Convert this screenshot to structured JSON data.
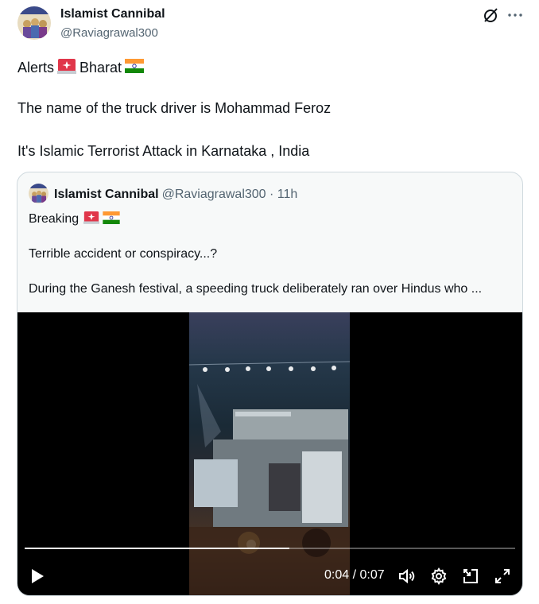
{
  "post": {
    "author_name": "Islamist Cannibal",
    "author_handle": "@Raviagrawal300",
    "lines": [
      {
        "before": "Alerts",
        "after": "Bharat"
      },
      {
        "text": "The name of the truck driver is Mohammad Feroz"
      },
      {
        "text": "It's Islamic Terrorist Attack in Karnataka , India"
      }
    ],
    "icons": [
      "grok-icon",
      "more-icon",
      "police-light-emoji",
      "india-flag-emoji"
    ]
  },
  "quoted": {
    "author_name": "Islamist Cannibal",
    "meta": "@Raviagrawal300 · 11h",
    "lines": [
      {
        "text": "Breaking"
      },
      {
        "text": "Terrible accident or conspiracy...?"
      },
      {
        "text": "During the Ganesh festival, a speeding truck deliberately ran over Hindus who ..."
      }
    ],
    "video": {
      "time_display": "0:04 / 0:07",
      "progress": 0.54,
      "controls": [
        "play-icon",
        "volume-icon",
        "settings-icon",
        "picture-in-picture-icon",
        "fullscreen-icon"
      ]
    }
  },
  "colors": {
    "text_primary": "#0f1419",
    "text_secondary": "#536471",
    "border": "#cfd9de",
    "quote_background": "#f7f9f9"
  }
}
